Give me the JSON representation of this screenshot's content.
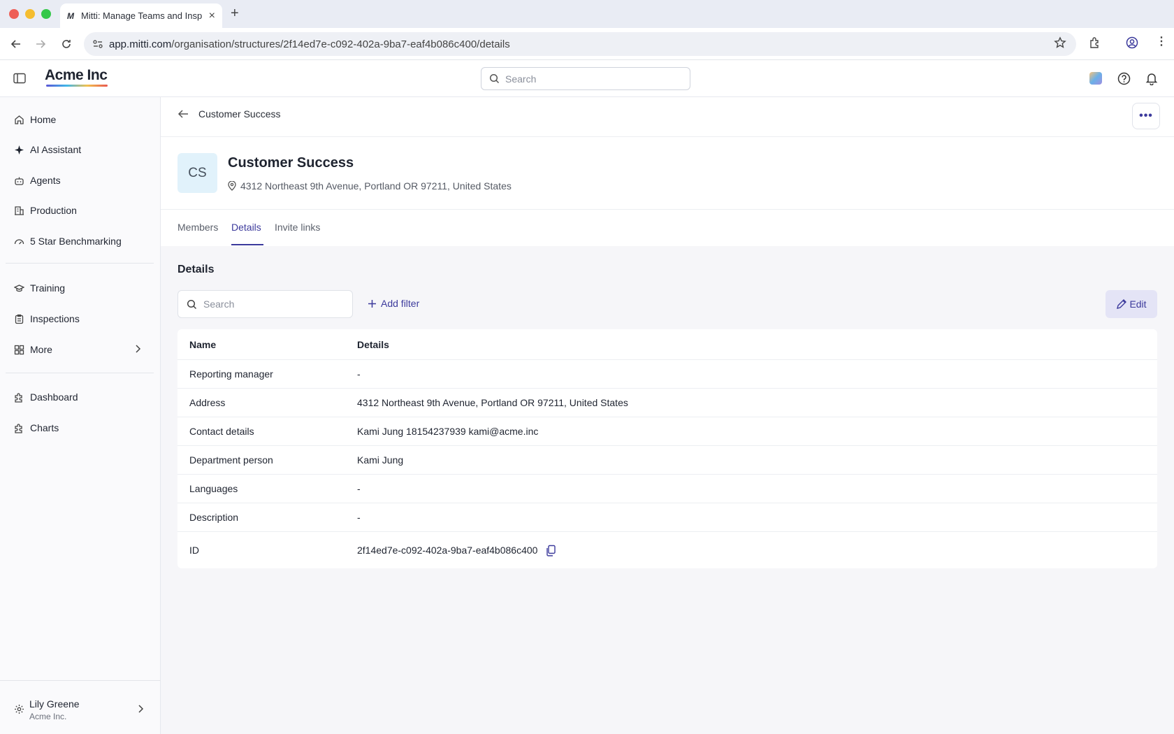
{
  "browser": {
    "tab_title": "Mitti: Manage Teams and Insp",
    "url_host": "app.mitti.com",
    "url_path": "/organisation/structures/2f14ed7e-c092-402a-9ba7-eaf4b086c400/details"
  },
  "header": {
    "logo": "Acme Inc",
    "search_placeholder": "Search"
  },
  "sidebar": {
    "items": [
      {
        "label": "Home",
        "icon": "home-icon"
      },
      {
        "label": "AI Assistant",
        "icon": "sparkle-icon"
      },
      {
        "label": "Agents",
        "icon": "robot-icon"
      },
      {
        "label": "Production",
        "icon": "building-icon"
      },
      {
        "label": "5 Star Benchmarking",
        "icon": "gauge-icon"
      },
      {
        "label": "Training",
        "icon": "graduation-cap-icon"
      },
      {
        "label": "Inspections",
        "icon": "clipboard-icon"
      },
      {
        "label": "More",
        "icon": "grid-icon"
      },
      {
        "label": "Dashboard",
        "icon": "puzzle-icon"
      },
      {
        "label": "Charts",
        "icon": "puzzle-icon"
      }
    ],
    "user_name": "Lily Greene",
    "user_org": "Acme Inc."
  },
  "page": {
    "breadcrumb": "Customer Success",
    "avatar_initials": "CS",
    "team_name": "Customer Success",
    "team_address": "4312 Northeast 9th Avenue, Portland OR 97211, United States",
    "tabs": [
      "Members",
      "Details",
      "Invite links"
    ],
    "active_tab": "Details",
    "section_title": "Details",
    "filter_search_placeholder": "Search",
    "add_filter_label": "Add filter",
    "edit_label": "Edit"
  },
  "table": {
    "headers": [
      "Name",
      "Details"
    ],
    "rows": [
      {
        "name": "Reporting manager",
        "value": "-"
      },
      {
        "name": "Address",
        "value": "4312 Northeast 9th Avenue, Portland OR 97211, United States"
      },
      {
        "name": "Contact details",
        "value": "Kami Jung 18154237939 kami@acme.inc"
      },
      {
        "name": "Department person",
        "value": "Kami Jung"
      },
      {
        "name": "Languages",
        "value": "-"
      },
      {
        "name": "Description",
        "value": "-"
      },
      {
        "name": "ID",
        "value": "2f14ed7e-c092-402a-9ba7-eaf4b086c400"
      }
    ]
  },
  "colors": {
    "accent": "#3c3a9c",
    "avatar_bg": "#e1f2fb",
    "edit_bg": "#e4e4f6"
  }
}
